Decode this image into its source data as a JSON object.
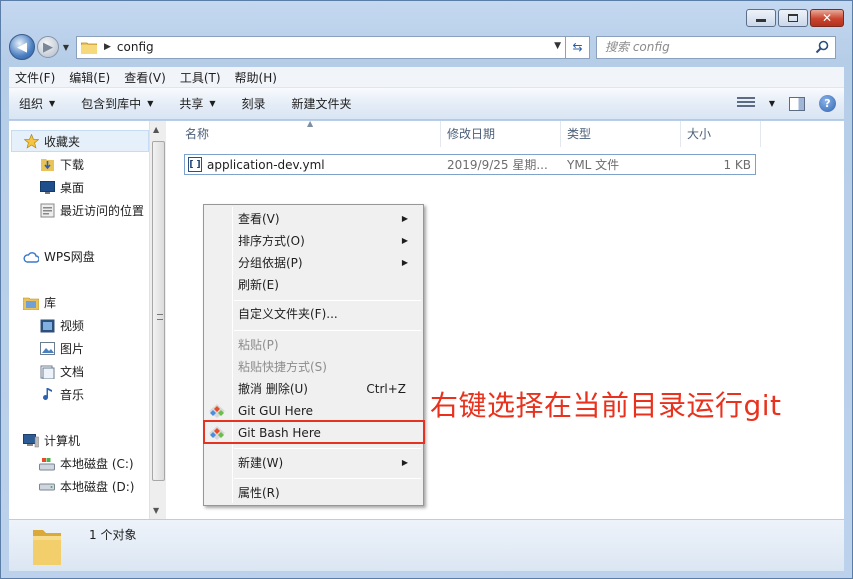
{
  "window": {
    "path": "config",
    "search_placeholder": "搜索 config"
  },
  "menubar": [
    "文件(F)",
    "编辑(E)",
    "查看(V)",
    "工具(T)",
    "帮助(H)"
  ],
  "commands": [
    "组织",
    "包含到库中",
    "共享",
    "刻录",
    "新建文件夹"
  ],
  "sidebar": {
    "favorites": "收藏夹",
    "fav_items": [
      "下载",
      "桌面",
      "最近访问的位置"
    ],
    "wps": "WPS网盘",
    "library": "库",
    "lib_items": [
      "视频",
      "图片",
      "文档",
      "音乐"
    ],
    "computer": "计算机",
    "drives": [
      "本地磁盘 (C:)",
      "本地磁盘 (D:)"
    ]
  },
  "columns": [
    "名称",
    "修改日期",
    "类型",
    "大小"
  ],
  "file": {
    "name": "application-dev.yml",
    "date": "2019/9/25 星期...",
    "type": "YML 文件",
    "size": "1 KB"
  },
  "context_menu": {
    "view": "查看(V)",
    "sort": "排序方式(O)",
    "group": "分组依据(P)",
    "refresh": "刷新(E)",
    "customize": "自定义文件夹(F)...",
    "paste": "粘贴(P)",
    "paste_shortcut": "粘贴快捷方式(S)",
    "undo": "撤消 删除(U)",
    "undo_shortcut": "Ctrl+Z",
    "git_gui": "Git GUI Here",
    "git_bash": "Git Bash Here",
    "new": "新建(W)",
    "properties": "属性(R)"
  },
  "annotation": "右键选择在当前目录运行git",
  "status": {
    "count": "1 个对象"
  },
  "colors": {
    "highlight": "#e53322",
    "annotation": "#e8321e"
  }
}
